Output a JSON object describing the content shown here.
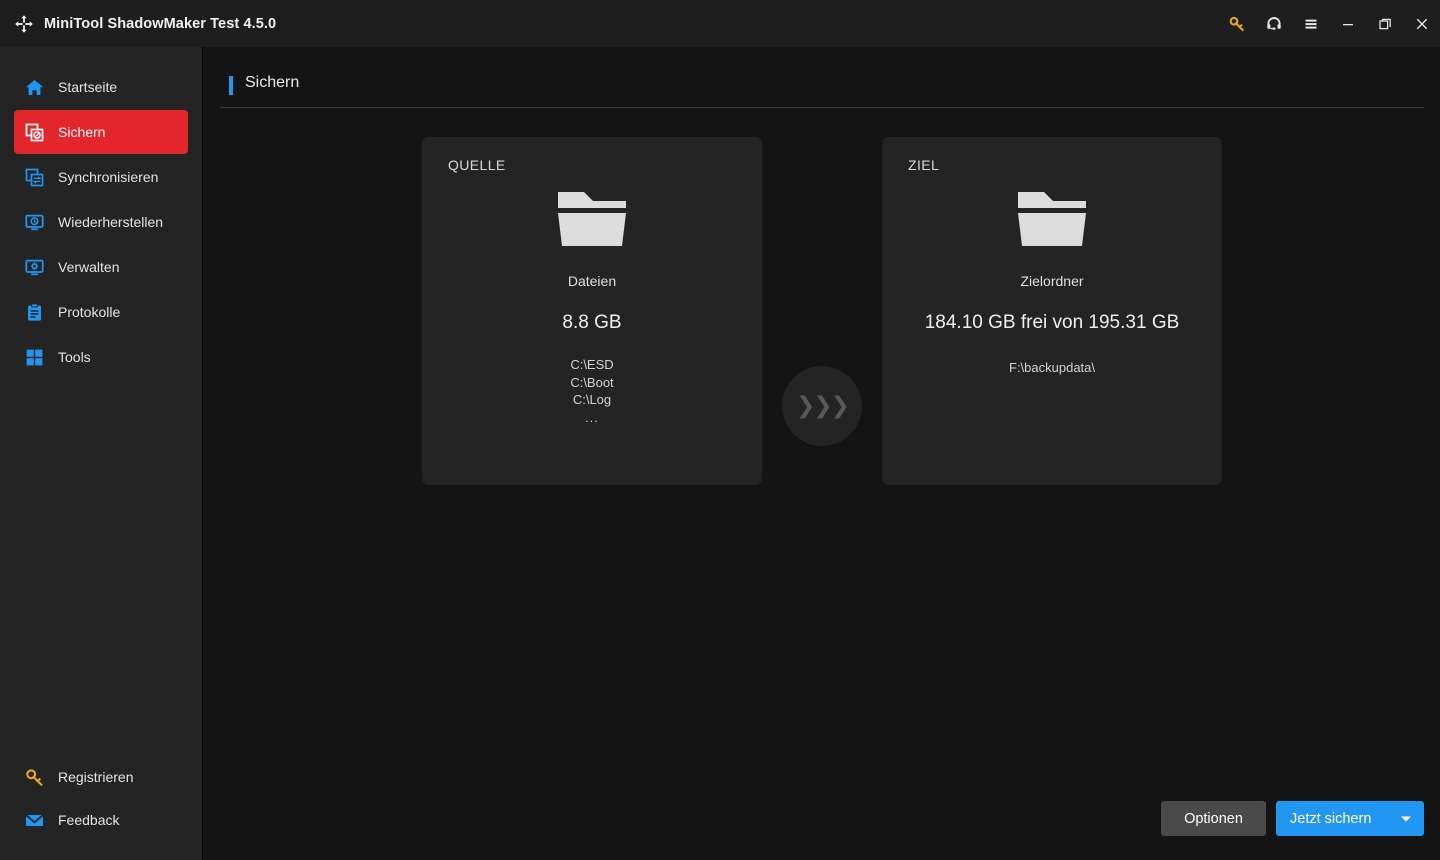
{
  "titlebar": {
    "app_title": "MiniTool ShadowMaker Test 4.5.0",
    "logo_icon": "shadowmaker-logo-icon",
    "buttons": [
      {
        "name": "register-key-icon",
        "label": "Registrieren",
        "color": "#f0a818"
      },
      {
        "name": "support-headset-icon",
        "label": "Support",
        "color": "#e6e6e6"
      },
      {
        "name": "menu-hamburger-icon",
        "label": "Menü",
        "color": "#e6e6e6"
      },
      {
        "name": "minimize-icon",
        "label": "Minimieren",
        "color": "#e6e6e6"
      },
      {
        "name": "maximize-icon",
        "label": "Maximieren",
        "color": "#e6e6e6"
      },
      {
        "name": "close-icon",
        "label": "Schließen",
        "color": "#e6e6e6"
      }
    ]
  },
  "sidebar": {
    "active_color": "#e3262b",
    "items": [
      {
        "label": "Startseite",
        "icon": "home-icon",
        "active": false
      },
      {
        "label": "Sichern",
        "icon": "backup-icon",
        "active": true
      },
      {
        "label": "Synchronisieren",
        "icon": "sync-icon",
        "active": false
      },
      {
        "label": "Wiederherstellen",
        "icon": "restore-icon",
        "active": false
      },
      {
        "label": "Verwalten",
        "icon": "manage-icon",
        "active": false
      },
      {
        "label": "Protokolle",
        "icon": "logs-icon",
        "active": false
      },
      {
        "label": "Tools",
        "icon": "tools-icon",
        "active": false
      }
    ],
    "bottom_items": [
      {
        "label": "Registrieren",
        "icon": "key-icon",
        "color": "#f0a818"
      },
      {
        "label": "Feedback",
        "icon": "envelope-icon",
        "color": "#2196f3"
      }
    ]
  },
  "page": {
    "title": "Sichern",
    "accent_color": "#2196f3"
  },
  "source_card": {
    "label": "QUELLE",
    "icon": "folder-icon",
    "type": "Dateien",
    "size": "8.8 GB",
    "paths": [
      "C:\\ESD",
      "C:\\Boot",
      "C:\\Log"
    ],
    "more": "..."
  },
  "transfer_arrow": {
    "icon": "chevrons-right-icon",
    "glyph": "❯❯❯"
  },
  "dest_card": {
    "label": "ZIEL",
    "icon": "folder-icon",
    "type": "Zielordner",
    "capacity": "184.10 GB frei von 195.31 GB",
    "path": "F:\\backupdata\\"
  },
  "actions": {
    "options_label": "Optionen",
    "backup_label": "Jetzt sichern",
    "dropdown_icon": "caret-down-icon"
  }
}
